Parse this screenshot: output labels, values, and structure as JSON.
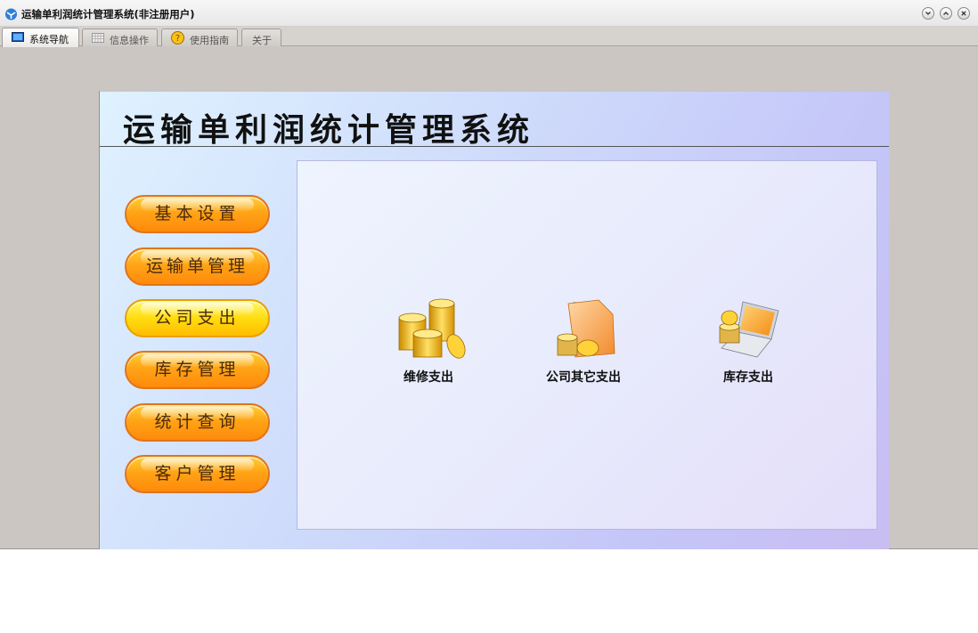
{
  "window": {
    "title": "运输单利润统计管理系统(非注册用户)",
    "buttons": [
      "minimize",
      "maximize",
      "close"
    ]
  },
  "tabs": [
    {
      "label": "系统导航",
      "icon": "monitor-icon",
      "active": true
    },
    {
      "label": "信息操作",
      "icon": "grid-icon",
      "active": false
    },
    {
      "label": "使用指南",
      "icon": "help-coin-icon",
      "active": false
    },
    {
      "label": "关于",
      "icon": "",
      "active": false
    }
  ],
  "main": {
    "title": "运输单利润统计管理系统",
    "nav": [
      {
        "label": "基本设置"
      },
      {
        "label": "运输单管理"
      },
      {
        "label": "公司支出"
      },
      {
        "label": "库存管理"
      },
      {
        "label": "统计查询"
      },
      {
        "label": "客户管理"
      }
    ],
    "functions": [
      {
        "label": "维修支出",
        "icon": "coin-stacks-icon"
      },
      {
        "label": "公司其它支出",
        "icon": "folder-coins-icon"
      },
      {
        "label": "库存支出",
        "icon": "laptop-coins-icon"
      }
    ]
  },
  "colors": {
    "button_orange": "#ff9a14",
    "button_yellow": "#ffdc10",
    "panel_blue": "#cfdcfb"
  }
}
